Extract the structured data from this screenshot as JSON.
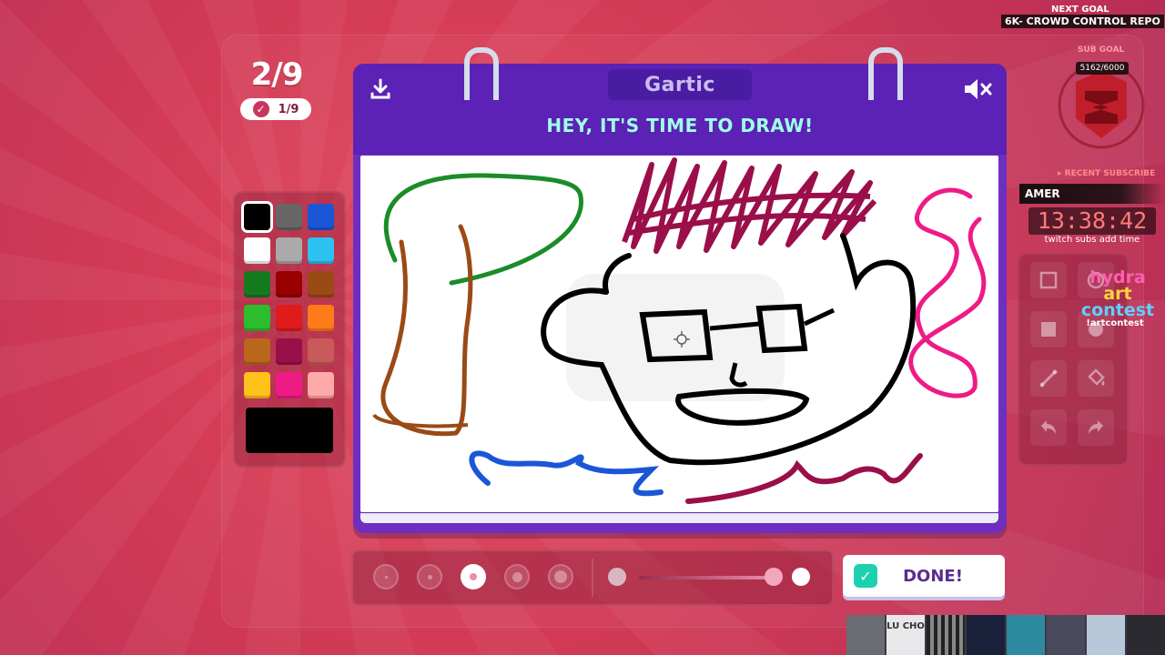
{
  "round": {
    "current": "2/9",
    "guessed": "1/9"
  },
  "game": {
    "logo": "Gartic",
    "headline": "HEY, IT'S TIME TO DRAW!"
  },
  "palette": {
    "colors": [
      "#000000",
      "#666666",
      "#1a56d6",
      "#ffffff",
      "#aaaaaa",
      "#2ec2f0",
      "#157a1e",
      "#990000",
      "#9a4a14",
      "#2cbd2c",
      "#e01b1b",
      "#ff7a1a",
      "#b8681a",
      "#9a0f4a",
      "#c85a5a",
      "#ffc21a",
      "#ee1a86",
      "#ffaaaa"
    ],
    "selected_index": 0,
    "current_color": "#000000"
  },
  "brush": {
    "sizes": 5,
    "selected_size_index": 2,
    "opacity_percent": 100
  },
  "buttons": {
    "done_label": "DONE!"
  },
  "overlay": {
    "next_goal_label": "NEXT GOAL",
    "next_goal_value": "6K- CROWD CONTROL REPO",
    "sub_goal_label": "SUB GOAL",
    "sub_goal_count": "5162/6000",
    "recent_label": "▸ RECENT SUBSCRIBE",
    "recent_name": "AMER",
    "timer": "13:38:42",
    "timer_caption": "twitch subs add time",
    "contest_words": [
      "hydra",
      "art",
      "contest"
    ],
    "contest_tag": "!artcontest",
    "cam_label": "LU CHO"
  },
  "icons": [
    "download-icon",
    "mute-icon",
    "check-icon",
    "rectangle-outline-icon",
    "rectangle-fill-icon",
    "line-icon",
    "fill-bucket-icon",
    "undo-icon",
    "redo-icon",
    "ellipse-icon"
  ]
}
